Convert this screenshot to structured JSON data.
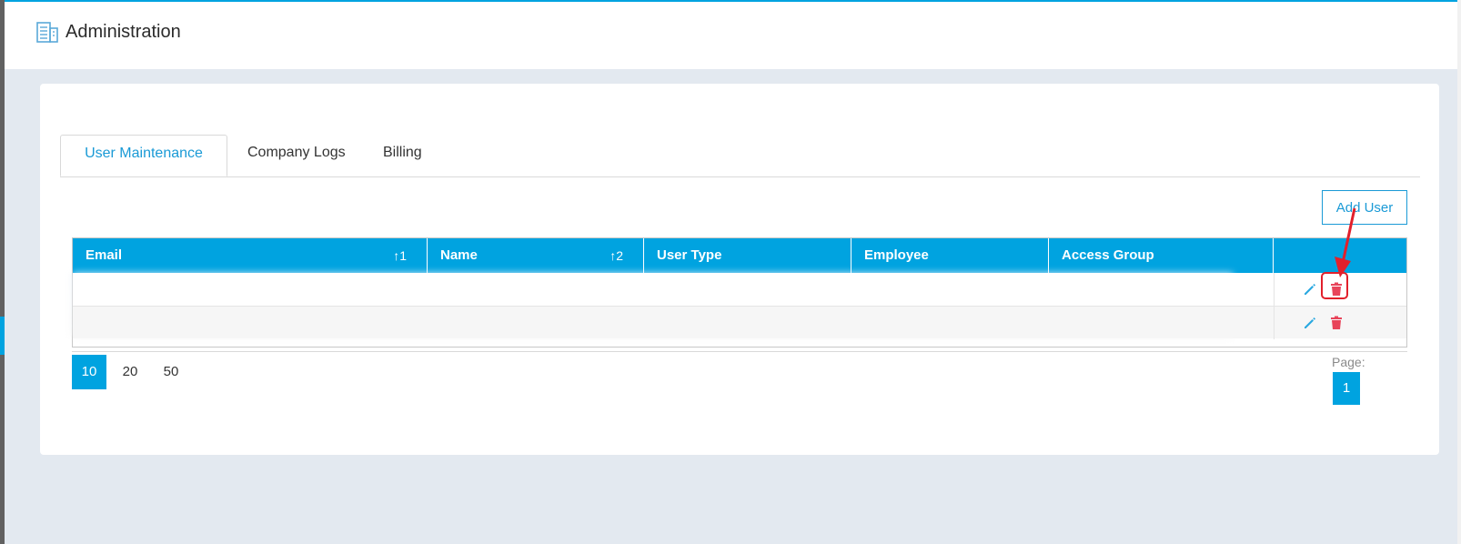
{
  "header": {
    "title": "Administration",
    "icon": "building-icon"
  },
  "tabs": [
    {
      "label": "User Maintenance",
      "active": true
    },
    {
      "label": "Company Logs",
      "active": false
    },
    {
      "label": "Billing",
      "active": false
    }
  ],
  "toolbar": {
    "add_user_label": "Add User"
  },
  "table": {
    "columns": [
      {
        "label": "Email",
        "sort": "↑1"
      },
      {
        "label": "Name",
        "sort": "↑2"
      },
      {
        "label": "User Type",
        "sort": ""
      },
      {
        "label": "Employee",
        "sort": ""
      },
      {
        "label": "Access Group",
        "sort": ""
      },
      {
        "label": "",
        "sort": ""
      }
    ],
    "rows": [
      {
        "email": "",
        "name": "",
        "user_type": "",
        "employee": "",
        "access_group": ""
      },
      {
        "email": "",
        "name": "",
        "user_type": "",
        "employee": "",
        "access_group": ""
      }
    ]
  },
  "pagination": {
    "page_sizes": [
      "10",
      "20",
      "50"
    ],
    "selected_page_size": "10",
    "page_label": "Page:",
    "current_page": "1"
  },
  "colors": {
    "accent": "#00a3e0",
    "delete": "#e8445a",
    "edit": "#29a8e0",
    "highlight": "#e2202b"
  }
}
